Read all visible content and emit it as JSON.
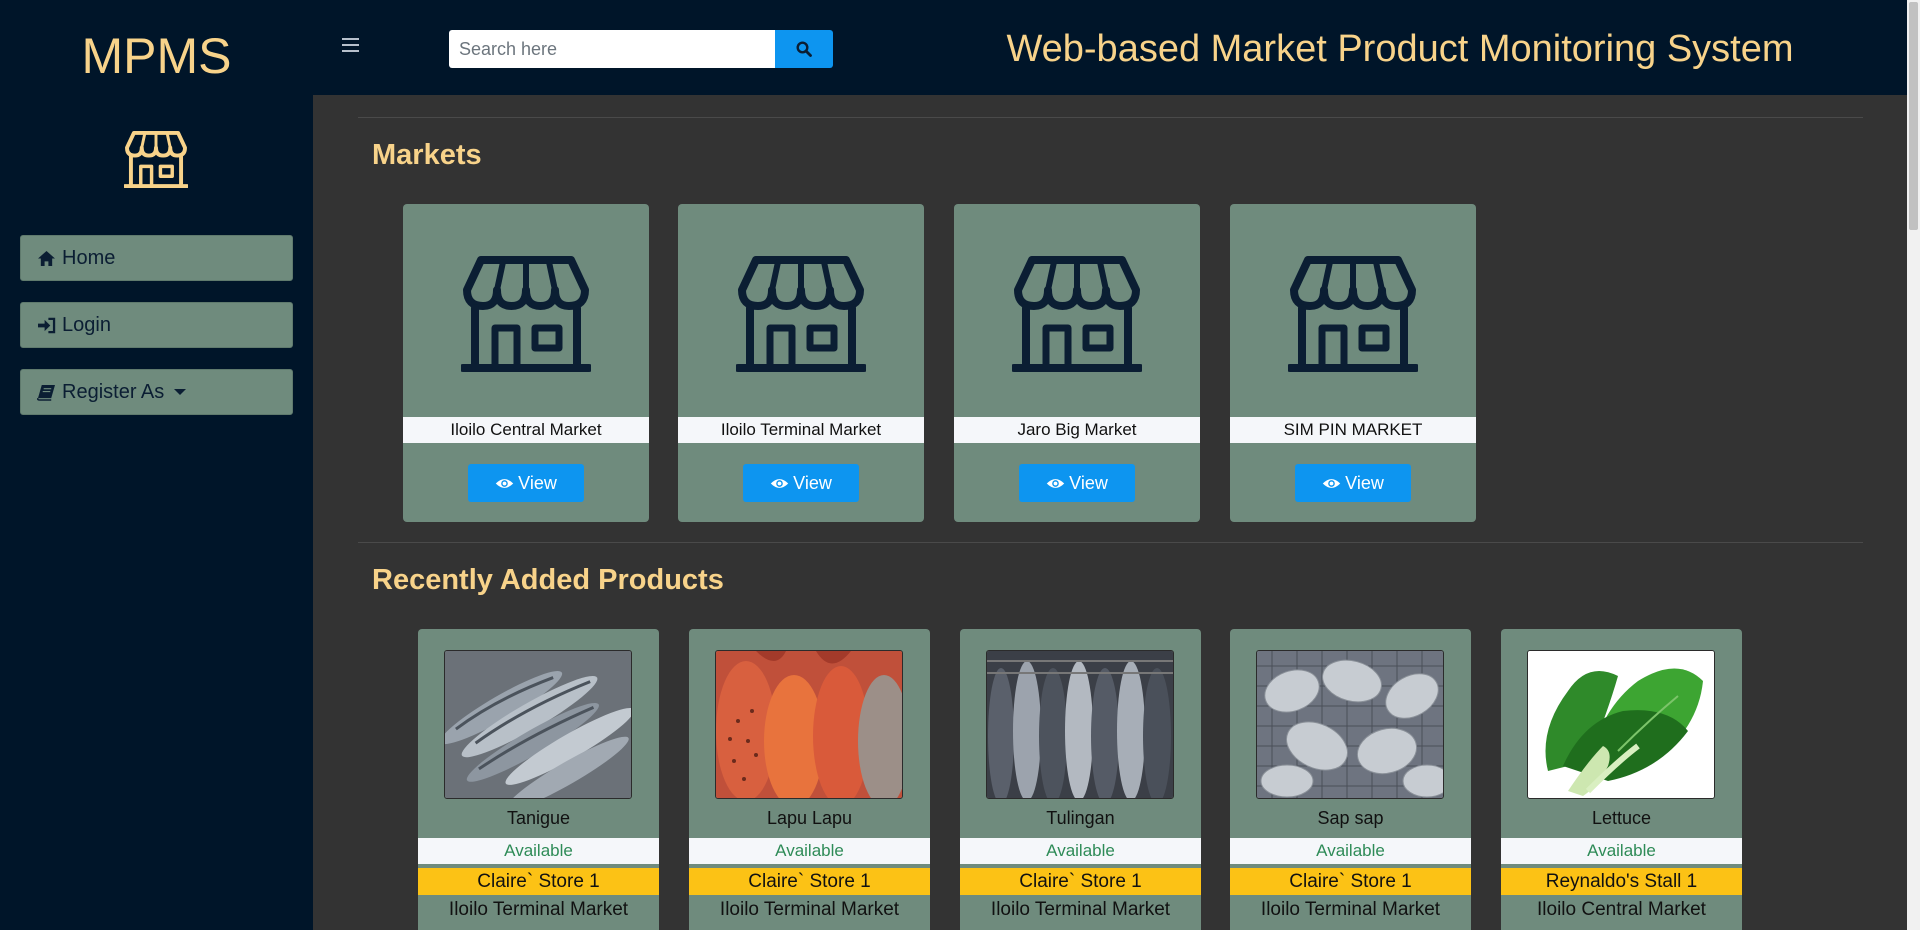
{
  "sidebar": {
    "brand": "MPMS",
    "brand_icon": "store-icon",
    "items": [
      {
        "label": "Home",
        "icon": "home-icon"
      },
      {
        "label": "Login",
        "icon": "sign-in-icon"
      },
      {
        "label": "Register As",
        "icon": "book-icon",
        "dropdown": true
      }
    ]
  },
  "header": {
    "menu_icon": "hamburger-icon",
    "search": {
      "placeholder": "Search here",
      "value": "",
      "button_icon": "search-icon"
    },
    "title": "Web-based Market Product Monitoring System"
  },
  "markets": {
    "title": "Markets",
    "view_label": "View",
    "items": [
      {
        "name": "Iloilo Central Market"
      },
      {
        "name": "Iloilo Terminal Market"
      },
      {
        "name": "Jaro Big Market"
      },
      {
        "name": "SIM PIN MARKET"
      }
    ]
  },
  "products": {
    "title": "Recently Added Products",
    "items": [
      {
        "name": "Tanigue",
        "status": "Available",
        "store": "Claire` Store 1",
        "market": "Iloilo Terminal Market"
      },
      {
        "name": "Lapu Lapu",
        "status": "Available",
        "store": "Claire` Store 1",
        "market": "Iloilo Terminal Market"
      },
      {
        "name": "Tulingan",
        "status": "Available",
        "store": "Claire` Store 1",
        "market": "Iloilo Terminal Market"
      },
      {
        "name": "Sap sap",
        "status": "Available",
        "store": "Claire` Store 1",
        "market": "Iloilo Terminal Market"
      },
      {
        "name": "Lettuce",
        "status": "Available",
        "store": "Reynaldo's Stall 1",
        "market": "Iloilo Central Market"
      }
    ]
  },
  "colors": {
    "navy": "#001529",
    "gold": "#f8d38a",
    "sage": "#6f8b7d",
    "primary": "#0d95f0",
    "amber": "#fcc215",
    "content_bg": "#333333"
  }
}
